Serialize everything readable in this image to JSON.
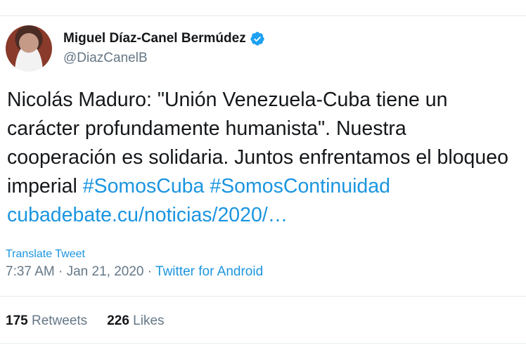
{
  "tweet": {
    "author": {
      "display_name": "Miguel Díaz-Canel Bermúdez",
      "handle": "@DiazCanelB",
      "verified": true
    },
    "text": "Nicolás Maduro: \"Unión Venezuela-Cuba tiene un carácter profundamente humanista\". Nuestra cooperación es solidaria. Juntos enfrentamos el bloqueo imperial",
    "hashtags": [
      "#SomosCuba",
      "#SomosContinuidad"
    ],
    "link": "cubadebate.cu/noticias/2020/…",
    "translate_label": "Translate Tweet",
    "time": "7:37 AM · Jan 21, 2020 · ",
    "source": "Twitter for Android",
    "retweets_count": "175",
    "retweets_label": "Retweets",
    "likes_count": "226",
    "likes_label": "Likes"
  },
  "colors": {
    "link": "#1b95e0",
    "muted": "#657786",
    "text": "#14171a",
    "verified": "#1da1f2"
  }
}
